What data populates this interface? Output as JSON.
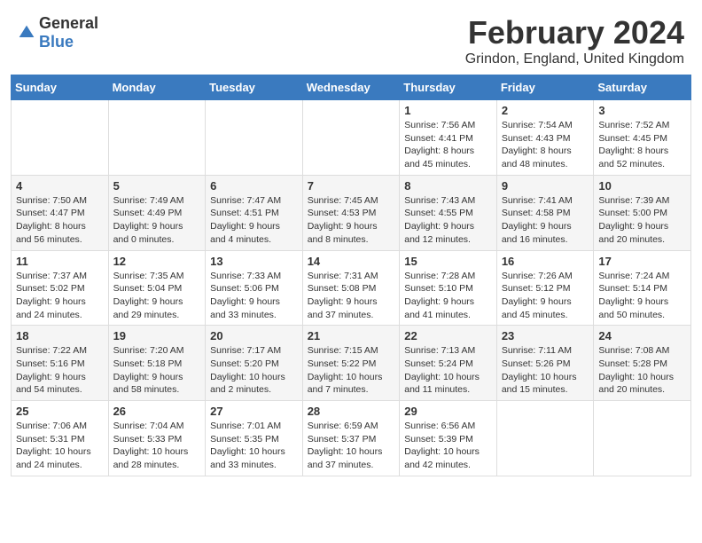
{
  "logo": {
    "general": "General",
    "blue": "Blue"
  },
  "title": "February 2024",
  "subtitle": "Grindon, England, United Kingdom",
  "days_of_week": [
    "Sunday",
    "Monday",
    "Tuesday",
    "Wednesday",
    "Thursday",
    "Friday",
    "Saturday"
  ],
  "weeks": [
    [
      {
        "num": "",
        "info": ""
      },
      {
        "num": "",
        "info": ""
      },
      {
        "num": "",
        "info": ""
      },
      {
        "num": "",
        "info": ""
      },
      {
        "num": "1",
        "info": "Sunrise: 7:56 AM\nSunset: 4:41 PM\nDaylight: 8 hours and 45 minutes."
      },
      {
        "num": "2",
        "info": "Sunrise: 7:54 AM\nSunset: 4:43 PM\nDaylight: 8 hours and 48 minutes."
      },
      {
        "num": "3",
        "info": "Sunrise: 7:52 AM\nSunset: 4:45 PM\nDaylight: 8 hours and 52 minutes."
      }
    ],
    [
      {
        "num": "4",
        "info": "Sunrise: 7:50 AM\nSunset: 4:47 PM\nDaylight: 8 hours and 56 minutes."
      },
      {
        "num": "5",
        "info": "Sunrise: 7:49 AM\nSunset: 4:49 PM\nDaylight: 9 hours and 0 minutes."
      },
      {
        "num": "6",
        "info": "Sunrise: 7:47 AM\nSunset: 4:51 PM\nDaylight: 9 hours and 4 minutes."
      },
      {
        "num": "7",
        "info": "Sunrise: 7:45 AM\nSunset: 4:53 PM\nDaylight: 9 hours and 8 minutes."
      },
      {
        "num": "8",
        "info": "Sunrise: 7:43 AM\nSunset: 4:55 PM\nDaylight: 9 hours and 12 minutes."
      },
      {
        "num": "9",
        "info": "Sunrise: 7:41 AM\nSunset: 4:58 PM\nDaylight: 9 hours and 16 minutes."
      },
      {
        "num": "10",
        "info": "Sunrise: 7:39 AM\nSunset: 5:00 PM\nDaylight: 9 hours and 20 minutes."
      }
    ],
    [
      {
        "num": "11",
        "info": "Sunrise: 7:37 AM\nSunset: 5:02 PM\nDaylight: 9 hours and 24 minutes."
      },
      {
        "num": "12",
        "info": "Sunrise: 7:35 AM\nSunset: 5:04 PM\nDaylight: 9 hours and 29 minutes."
      },
      {
        "num": "13",
        "info": "Sunrise: 7:33 AM\nSunset: 5:06 PM\nDaylight: 9 hours and 33 minutes."
      },
      {
        "num": "14",
        "info": "Sunrise: 7:31 AM\nSunset: 5:08 PM\nDaylight: 9 hours and 37 minutes."
      },
      {
        "num": "15",
        "info": "Sunrise: 7:28 AM\nSunset: 5:10 PM\nDaylight: 9 hours and 41 minutes."
      },
      {
        "num": "16",
        "info": "Sunrise: 7:26 AM\nSunset: 5:12 PM\nDaylight: 9 hours and 45 minutes."
      },
      {
        "num": "17",
        "info": "Sunrise: 7:24 AM\nSunset: 5:14 PM\nDaylight: 9 hours and 50 minutes."
      }
    ],
    [
      {
        "num": "18",
        "info": "Sunrise: 7:22 AM\nSunset: 5:16 PM\nDaylight: 9 hours and 54 minutes."
      },
      {
        "num": "19",
        "info": "Sunrise: 7:20 AM\nSunset: 5:18 PM\nDaylight: 9 hours and 58 minutes."
      },
      {
        "num": "20",
        "info": "Sunrise: 7:17 AM\nSunset: 5:20 PM\nDaylight: 10 hours and 2 minutes."
      },
      {
        "num": "21",
        "info": "Sunrise: 7:15 AM\nSunset: 5:22 PM\nDaylight: 10 hours and 7 minutes."
      },
      {
        "num": "22",
        "info": "Sunrise: 7:13 AM\nSunset: 5:24 PM\nDaylight: 10 hours and 11 minutes."
      },
      {
        "num": "23",
        "info": "Sunrise: 7:11 AM\nSunset: 5:26 PM\nDaylight: 10 hours and 15 minutes."
      },
      {
        "num": "24",
        "info": "Sunrise: 7:08 AM\nSunset: 5:28 PM\nDaylight: 10 hours and 20 minutes."
      }
    ],
    [
      {
        "num": "25",
        "info": "Sunrise: 7:06 AM\nSunset: 5:31 PM\nDaylight: 10 hours and 24 minutes."
      },
      {
        "num": "26",
        "info": "Sunrise: 7:04 AM\nSunset: 5:33 PM\nDaylight: 10 hours and 28 minutes."
      },
      {
        "num": "27",
        "info": "Sunrise: 7:01 AM\nSunset: 5:35 PM\nDaylight: 10 hours and 33 minutes."
      },
      {
        "num": "28",
        "info": "Sunrise: 6:59 AM\nSunset: 5:37 PM\nDaylight: 10 hours and 37 minutes."
      },
      {
        "num": "29",
        "info": "Sunrise: 6:56 AM\nSunset: 5:39 PM\nDaylight: 10 hours and 42 minutes."
      },
      {
        "num": "",
        "info": ""
      },
      {
        "num": "",
        "info": ""
      }
    ]
  ]
}
